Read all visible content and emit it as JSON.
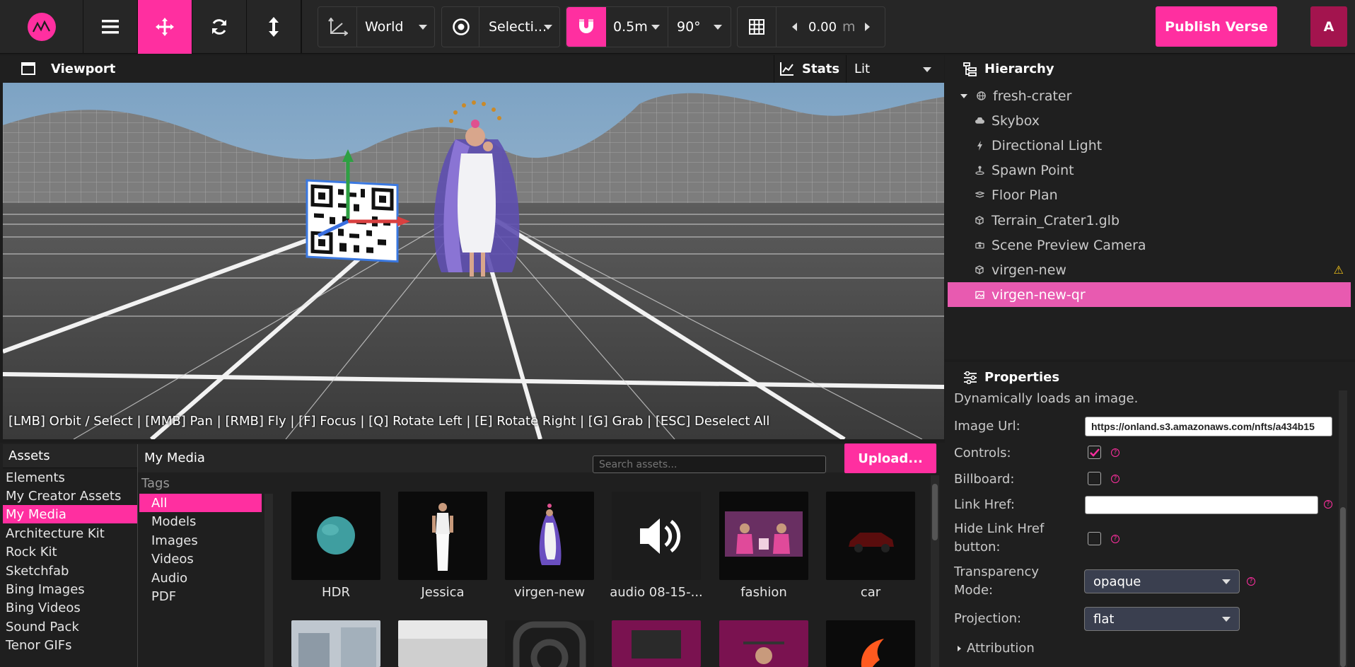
{
  "toolbar": {
    "logo_icon": "verse-logo-icon",
    "tools": [
      "menu-icon",
      "move-icon",
      "rotate-icon",
      "scale-icon"
    ],
    "space_label": "World",
    "pivot_label": "Selecti...",
    "snap_translate": "0.5m",
    "snap_rotate": "90°",
    "grid_height": "0.00",
    "grid_unit": "m",
    "publish_label": "Publish Verse",
    "avatar_initial": "A",
    "accent_color": "#ff2fa0"
  },
  "viewport": {
    "title": "Viewport",
    "stats_label": "Stats",
    "render_mode": "Lit",
    "hint": "[LMB] Orbit / Select | [MMB] Pan | [RMB] Fly | [F] Focus | [Q] Rotate Left | [E] Rotate Right | [G] Grab | [ESC] Deselect All"
  },
  "hierarchy": {
    "title": "Hierarchy",
    "items": [
      {
        "label": "fresh-crater",
        "icon": "globe-icon"
      },
      {
        "label": "Skybox",
        "icon": "cloud-icon"
      },
      {
        "label": "Directional Light",
        "icon": "bolt-icon"
      },
      {
        "label": "Spawn Point",
        "icon": "spawn-icon"
      },
      {
        "label": "Floor Plan",
        "icon": "floor-plan-icon"
      },
      {
        "label": "Terrain_Crater1.glb",
        "icon": "cube-icon"
      },
      {
        "label": "Scene Preview Camera",
        "icon": "camera-icon"
      },
      {
        "label": "virgen-new",
        "icon": "cube-icon",
        "warning": "⚠"
      },
      {
        "label": "virgen-new-qr",
        "icon": "image-icon"
      }
    ]
  },
  "properties": {
    "title": "Properties",
    "description": "Dynamically loads an image.",
    "image_url_label": "Image Url:",
    "image_url_value": "https://onland.s3.amazonaws.com/nfts/a434b15",
    "controls_label": "Controls:",
    "controls_checked": true,
    "billboard_label": "Billboard:",
    "link_href_label": "Link Href:",
    "link_href_value": "",
    "hide_link_label_1": "Hide Link Href",
    "hide_link_label_2": "button:",
    "transparency_label_1": "Transparency",
    "transparency_label_2": "Mode:",
    "transparency_value": "opaque",
    "projection_label": "Projection:",
    "projection_value": "flat",
    "attribution_label": "Attribution",
    "help_glyph": "?"
  },
  "assets": {
    "title": "Assets",
    "categories": [
      "Elements",
      "My Creator Assets",
      "My Media",
      "Architecture Kit",
      "Rock Kit",
      "Sketchfab",
      "Bing Images",
      "Bing Videos",
      "Sound Pack",
      "Tenor GIFs"
    ],
    "active_category": "My Media",
    "section_title": "My Media",
    "search_placeholder": "Search assets...",
    "upload_label": "Upload...",
    "tags_title": "Tags",
    "tags": [
      "All",
      "Models",
      "Images",
      "Videos",
      "Audio",
      "PDF"
    ],
    "items": [
      {
        "caption": "HDR",
        "thumb": "hdr-sphere"
      },
      {
        "caption": "Jessica",
        "thumb": "person-model"
      },
      {
        "caption": "virgen-new",
        "thumb": "virgen-model"
      },
      {
        "caption": "audio 08-15-...",
        "thumb": "speaker-icon"
      },
      {
        "caption": "fashion",
        "thumb": "fashion-photo"
      },
      {
        "caption": "car",
        "thumb": "car-model"
      }
    ]
  }
}
